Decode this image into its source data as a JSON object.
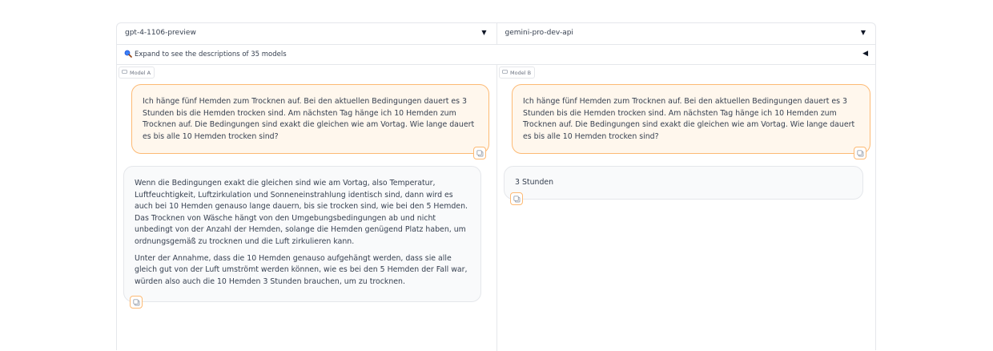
{
  "selectors": {
    "model_a": "gpt-4-1106-preview",
    "model_b": "gemini-pro-dev-api",
    "caret_icon": "caret-down-icon"
  },
  "expand": {
    "icon": "magnifier-icon",
    "text": "Expand to see the descriptions of 35 models",
    "toggle_icon": "triangle-left-icon"
  },
  "panels": {
    "a": {
      "label": "Model A",
      "user_message": "Ich hänge fünf Hemden zum Trocknen auf. Bei den aktuellen Bedingungen dauert es 3 Stunden bis die Hemden trocken sind. Am nächsten Tag hänge ich 10 Hemden zum Trocknen auf. Die Bedingungen sind exakt die gleichen wie am Vortag. Wie lange dauert es bis alle 10 Hemden trocken sind?",
      "bot_paragraphs": [
        "Wenn die Bedingungen exakt die gleichen sind wie am Vortag, also Temperatur, Luftfeuchtigkeit, Luftzirkulation und Sonneneinstrahlung identisch sind, dann wird es auch bei 10 Hemden genauso lange dauern, bis sie trocken sind, wie bei den 5 Hemden. Das Trocknen von Wäsche hängt von den Umgebungsbedingungen ab und nicht unbedingt von der Anzahl der Hemden, solange die Hemden genügend Platz haben, um ordnungsgemäß zu trocknen und die Luft zirkulieren kann.",
        "Unter der Annahme, dass die 10 Hemden genauso aufgehängt werden, dass sie alle gleich gut von der Luft umströmt werden können, wie es bei den 5 Hemden der Fall war, würden also auch die 10 Hemden 3 Stunden brauchen, um zu trocknen."
      ]
    },
    "b": {
      "label": "Model B",
      "user_message": "Ich hänge fünf Hemden zum Trocknen auf. Bei den aktuellen Bedingungen dauert es 3 Stunden bis die Hemden trocken sind. Am nächsten Tag hänge ich 10 Hemden zum Trocknen auf. Die Bedingungen sind exakt die gleichen wie am Vortag. Wie lange dauert es bis alle 10 Hemden trocken sind?",
      "bot_paragraphs": [
        "3 Stunden"
      ]
    }
  },
  "icons": {
    "copy": "copy-icon",
    "chat": "chat-bubble-icon"
  },
  "colors": {
    "user_bubble_bg": "#fff7ed",
    "user_bubble_border": "#fdba74",
    "bot_bubble_bg": "#f9fafb",
    "accent_blue": "#2563eb"
  }
}
